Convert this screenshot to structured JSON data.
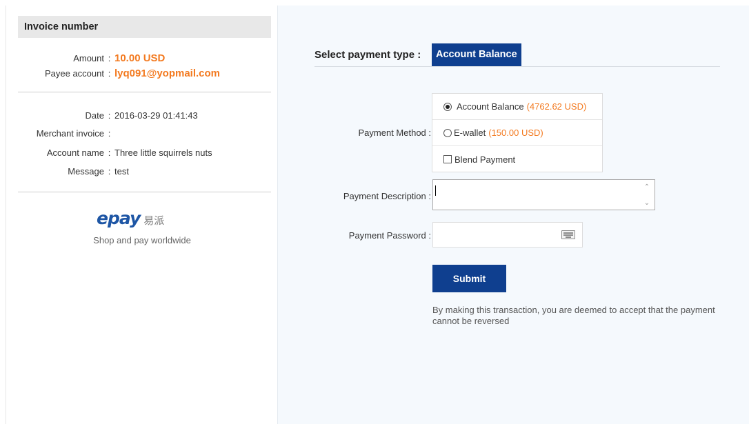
{
  "invoice": {
    "header": "Invoice number",
    "amount_label": "Amount",
    "amount_value": "10.00 USD",
    "payee_label": "Payee account",
    "payee_value": "lyq091@yopmail.com",
    "date_label": "Date",
    "date_value": "2016-03-29 01:41:43",
    "merchant_invoice_label": "Merchant invoice",
    "merchant_invoice_value": "",
    "account_name_label": "Account name",
    "account_name_value": "Three little squirrels nuts",
    "message_label": "Message",
    "message_value": "test",
    "separator": ":"
  },
  "brand": {
    "logo_en": "epay",
    "logo_cn": "易派",
    "tagline": "Shop and pay worldwide"
  },
  "payment": {
    "type_label": "Select payment type :",
    "type_value": "Account Balance",
    "method_label": "Payment Method :",
    "methods": [
      {
        "label": "Account Balance",
        "amount": "(4762.62 USD)",
        "selected": true,
        "kind": "radio"
      },
      {
        "label": "E-wallet",
        "amount": "(150.00 USD)",
        "selected": false,
        "kind": "radio"
      },
      {
        "label": "Blend Payment",
        "amount": "",
        "selected": false,
        "kind": "checkbox"
      }
    ],
    "description_label": "Payment Description :",
    "description_value": "",
    "password_label": "Payment Password :",
    "password_value": "",
    "submit_label": "Submit",
    "notice": "By making this transaction, you are deemed to accept that the payment cannot be reversed"
  },
  "colors": {
    "accent_orange": "#f37a20",
    "brand_blue": "#0f3f8f",
    "panel_bg": "#f5f9fd"
  },
  "icons": {
    "keyboard": "keyboard-icon",
    "radio_selected": "radio-selected-icon",
    "radio_unselected": "radio-unselected-icon",
    "checkbox": "checkbox-icon"
  }
}
